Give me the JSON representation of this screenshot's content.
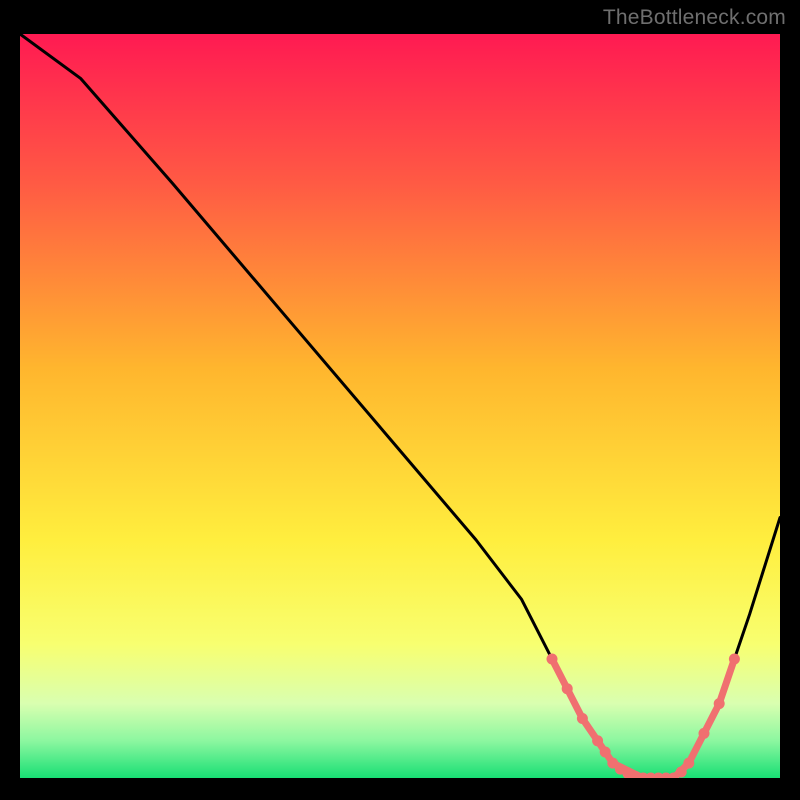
{
  "watermark": "TheBottleneck.com",
  "chart_data": {
    "type": "line",
    "title": "",
    "xlabel": "",
    "ylabel": "",
    "xlim": [
      0,
      100
    ],
    "ylim": [
      0,
      100
    ],
    "gradient_colors_top_to_bottom": [
      "#ff1a52",
      "#ff6a3a",
      "#ffcf2a",
      "#ffff50",
      "#e2ffb0",
      "#20e27a"
    ],
    "curve": {
      "description": "Bottleneck percentage vs parameter; sharp V-shape with minimum plateau around x≈78–88",
      "x": [
        0,
        8,
        20,
        35,
        50,
        60,
        66,
        70,
        74,
        78,
        82,
        86,
        88,
        92,
        96,
        100
      ],
      "y": [
        100,
        94,
        80,
        62,
        44,
        32,
        24,
        16,
        8,
        2,
        0,
        0,
        2,
        10,
        22,
        35
      ]
    },
    "valley_highlight": {
      "color": "#f07070",
      "segments": [
        {
          "x": [
            70,
            72,
            74
          ],
          "y": [
            16,
            12,
            8
          ]
        },
        {
          "x": [
            74,
            78,
            82,
            86,
            88
          ],
          "y": [
            8,
            2,
            0,
            0,
            2
          ]
        },
        {
          "x": [
            88,
            90,
            92
          ],
          "y": [
            2,
            6,
            10
          ]
        },
        {
          "x": [
            92,
            94
          ],
          "y": [
            10,
            16
          ]
        }
      ],
      "dots": {
        "x": [
          70,
          72,
          74,
          76,
          77,
          78,
          79,
          80,
          81,
          82,
          83,
          84,
          85,
          86,
          87,
          88,
          90,
          92,
          94
        ],
        "y": [
          16,
          12,
          8,
          5,
          3.5,
          2,
          1.2,
          0.6,
          0.2,
          0,
          0,
          0,
          0,
          0,
          0.8,
          2,
          6,
          10,
          16
        ]
      }
    }
  }
}
